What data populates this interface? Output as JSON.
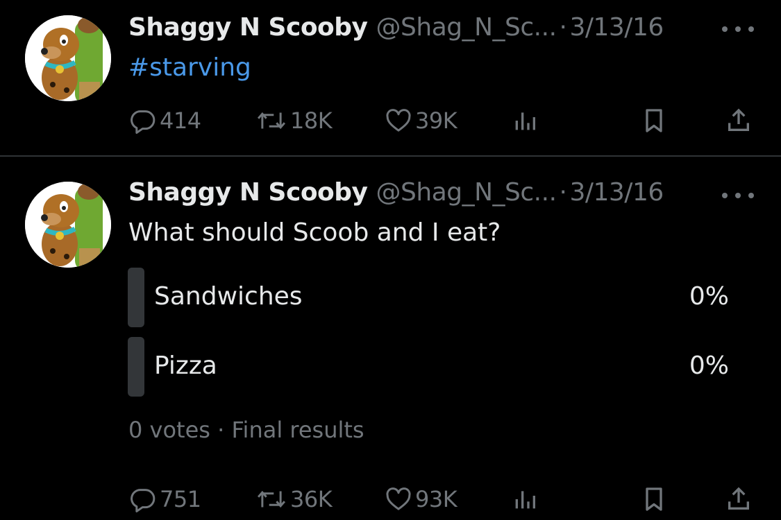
{
  "tweets": [
    {
      "author_name": "Shaggy N Scooby",
      "handle": "@Shag_N_Sc...",
      "separator": "·",
      "date": "3/13/16",
      "text": "#starving",
      "actions": {
        "replies": "414",
        "retweets": "18K",
        "likes": "39K"
      }
    },
    {
      "author_name": "Shaggy N Scooby",
      "handle": "@Shag_N_Sc...",
      "separator": "·",
      "date": "3/13/16",
      "text": "What should Scoob and I eat?",
      "poll": {
        "options": [
          {
            "label": "Sandwiches",
            "percent": "0%"
          },
          {
            "label": "Pizza",
            "percent": "0%"
          }
        ],
        "meta": "0 votes · Final results"
      },
      "actions": {
        "replies": "751",
        "retweets": "36K",
        "likes": "93K"
      }
    }
  ],
  "icons": [
    "avatar-image",
    "more-icon",
    "reply-icon",
    "retweet-icon",
    "like-icon",
    "views-icon",
    "bookmark-icon",
    "share-icon"
  ],
  "colors": {
    "background": "#000000",
    "text": "#e7e9ea",
    "secondary": "#71767b",
    "hashtag": "#4a99e9",
    "poll_bar": "#333639",
    "divider": "#2f3336"
  }
}
